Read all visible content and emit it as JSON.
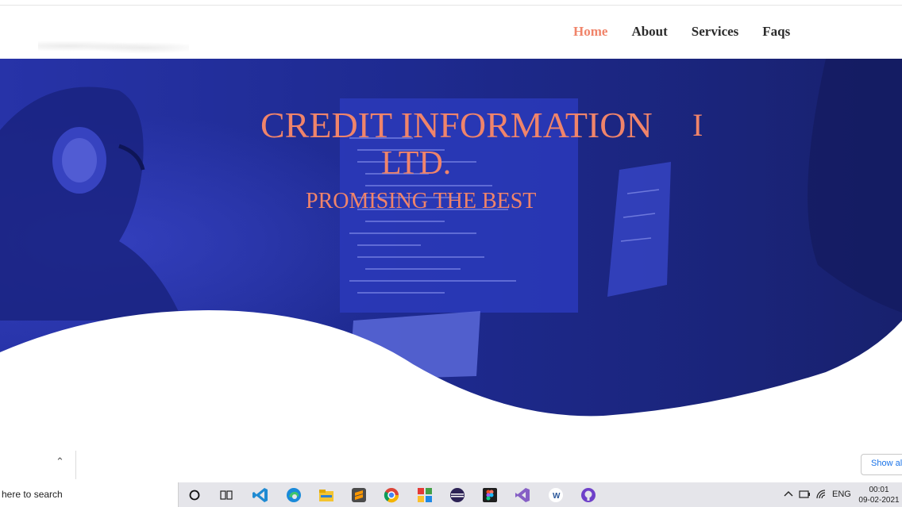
{
  "nav": {
    "items": [
      {
        "label": "Home",
        "active": true
      },
      {
        "label": "About",
        "active": false
      },
      {
        "label": "Services",
        "active": false
      },
      {
        "label": "Faqs",
        "active": false
      }
    ]
  },
  "hero": {
    "title_line1": "CREDIT INFORMATION",
    "title_line2": "LTD.",
    "cursor_glyph": "I",
    "tagline": "PROMISING THE BEST"
  },
  "download_bar": {
    "show_all_label": "Show all"
  },
  "taskbar": {
    "search_placeholder": "here to search",
    "language": "ENG",
    "time": "00:01",
    "date": "09-02-2021",
    "pinned_apps": [
      "cortana-icon",
      "task-view-icon",
      "vscode-icon",
      "edge-icon",
      "file-explorer-icon",
      "sublime-icon",
      "chrome-icon",
      "app-grid-icon",
      "eclipse-icon",
      "figma-icon",
      "visual-studio-icon",
      "word-icon",
      "github-icon"
    ]
  },
  "colors": {
    "accent": "#f0846a",
    "hero_blue": "#1f2a8a",
    "nav_text": "#2b2b2b"
  }
}
